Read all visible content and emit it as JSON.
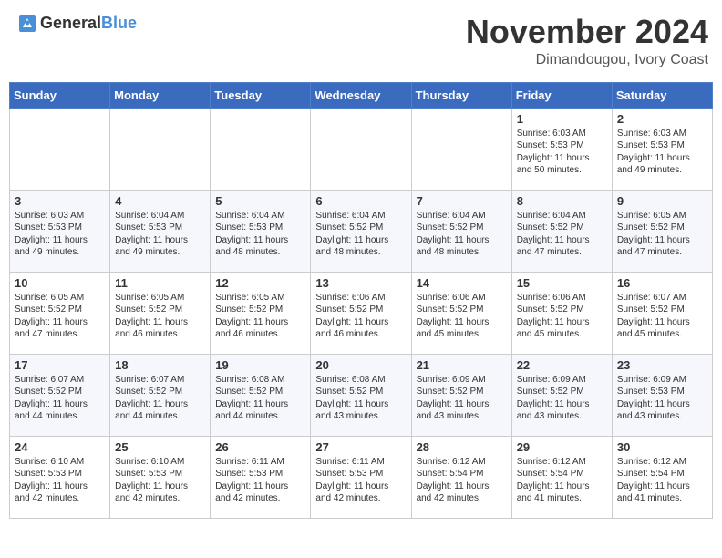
{
  "header": {
    "logo_general": "General",
    "logo_blue": "Blue",
    "month": "November 2024",
    "location": "Dimandougou, Ivory Coast"
  },
  "days_of_week": [
    "Sunday",
    "Monday",
    "Tuesday",
    "Wednesday",
    "Thursday",
    "Friday",
    "Saturday"
  ],
  "weeks": [
    [
      {
        "day": "",
        "info": ""
      },
      {
        "day": "",
        "info": ""
      },
      {
        "day": "",
        "info": ""
      },
      {
        "day": "",
        "info": ""
      },
      {
        "day": "",
        "info": ""
      },
      {
        "day": "1",
        "info": "Sunrise: 6:03 AM\nSunset: 5:53 PM\nDaylight: 11 hours\nand 50 minutes."
      },
      {
        "day": "2",
        "info": "Sunrise: 6:03 AM\nSunset: 5:53 PM\nDaylight: 11 hours\nand 49 minutes."
      }
    ],
    [
      {
        "day": "3",
        "info": "Sunrise: 6:03 AM\nSunset: 5:53 PM\nDaylight: 11 hours\nand 49 minutes."
      },
      {
        "day": "4",
        "info": "Sunrise: 6:04 AM\nSunset: 5:53 PM\nDaylight: 11 hours\nand 49 minutes."
      },
      {
        "day": "5",
        "info": "Sunrise: 6:04 AM\nSunset: 5:53 PM\nDaylight: 11 hours\nand 48 minutes."
      },
      {
        "day": "6",
        "info": "Sunrise: 6:04 AM\nSunset: 5:52 PM\nDaylight: 11 hours\nand 48 minutes."
      },
      {
        "day": "7",
        "info": "Sunrise: 6:04 AM\nSunset: 5:52 PM\nDaylight: 11 hours\nand 48 minutes."
      },
      {
        "day": "8",
        "info": "Sunrise: 6:04 AM\nSunset: 5:52 PM\nDaylight: 11 hours\nand 47 minutes."
      },
      {
        "day": "9",
        "info": "Sunrise: 6:05 AM\nSunset: 5:52 PM\nDaylight: 11 hours\nand 47 minutes."
      }
    ],
    [
      {
        "day": "10",
        "info": "Sunrise: 6:05 AM\nSunset: 5:52 PM\nDaylight: 11 hours\nand 47 minutes."
      },
      {
        "day": "11",
        "info": "Sunrise: 6:05 AM\nSunset: 5:52 PM\nDaylight: 11 hours\nand 46 minutes."
      },
      {
        "day": "12",
        "info": "Sunrise: 6:05 AM\nSunset: 5:52 PM\nDaylight: 11 hours\nand 46 minutes."
      },
      {
        "day": "13",
        "info": "Sunrise: 6:06 AM\nSunset: 5:52 PM\nDaylight: 11 hours\nand 46 minutes."
      },
      {
        "day": "14",
        "info": "Sunrise: 6:06 AM\nSunset: 5:52 PM\nDaylight: 11 hours\nand 45 minutes."
      },
      {
        "day": "15",
        "info": "Sunrise: 6:06 AM\nSunset: 5:52 PM\nDaylight: 11 hours\nand 45 minutes."
      },
      {
        "day": "16",
        "info": "Sunrise: 6:07 AM\nSunset: 5:52 PM\nDaylight: 11 hours\nand 45 minutes."
      }
    ],
    [
      {
        "day": "17",
        "info": "Sunrise: 6:07 AM\nSunset: 5:52 PM\nDaylight: 11 hours\nand 44 minutes."
      },
      {
        "day": "18",
        "info": "Sunrise: 6:07 AM\nSunset: 5:52 PM\nDaylight: 11 hours\nand 44 minutes."
      },
      {
        "day": "19",
        "info": "Sunrise: 6:08 AM\nSunset: 5:52 PM\nDaylight: 11 hours\nand 44 minutes."
      },
      {
        "day": "20",
        "info": "Sunrise: 6:08 AM\nSunset: 5:52 PM\nDaylight: 11 hours\nand 43 minutes."
      },
      {
        "day": "21",
        "info": "Sunrise: 6:09 AM\nSunset: 5:52 PM\nDaylight: 11 hours\nand 43 minutes."
      },
      {
        "day": "22",
        "info": "Sunrise: 6:09 AM\nSunset: 5:52 PM\nDaylight: 11 hours\nand 43 minutes."
      },
      {
        "day": "23",
        "info": "Sunrise: 6:09 AM\nSunset: 5:53 PM\nDaylight: 11 hours\nand 43 minutes."
      }
    ],
    [
      {
        "day": "24",
        "info": "Sunrise: 6:10 AM\nSunset: 5:53 PM\nDaylight: 11 hours\nand 42 minutes."
      },
      {
        "day": "25",
        "info": "Sunrise: 6:10 AM\nSunset: 5:53 PM\nDaylight: 11 hours\nand 42 minutes."
      },
      {
        "day": "26",
        "info": "Sunrise: 6:11 AM\nSunset: 5:53 PM\nDaylight: 11 hours\nand 42 minutes."
      },
      {
        "day": "27",
        "info": "Sunrise: 6:11 AM\nSunset: 5:53 PM\nDaylight: 11 hours\nand 42 minutes."
      },
      {
        "day": "28",
        "info": "Sunrise: 6:12 AM\nSunset: 5:54 PM\nDaylight: 11 hours\nand 42 minutes."
      },
      {
        "day": "29",
        "info": "Sunrise: 6:12 AM\nSunset: 5:54 PM\nDaylight: 11 hours\nand 41 minutes."
      },
      {
        "day": "30",
        "info": "Sunrise: 6:12 AM\nSunset: 5:54 PM\nDaylight: 11 hours\nand 41 minutes."
      }
    ]
  ]
}
